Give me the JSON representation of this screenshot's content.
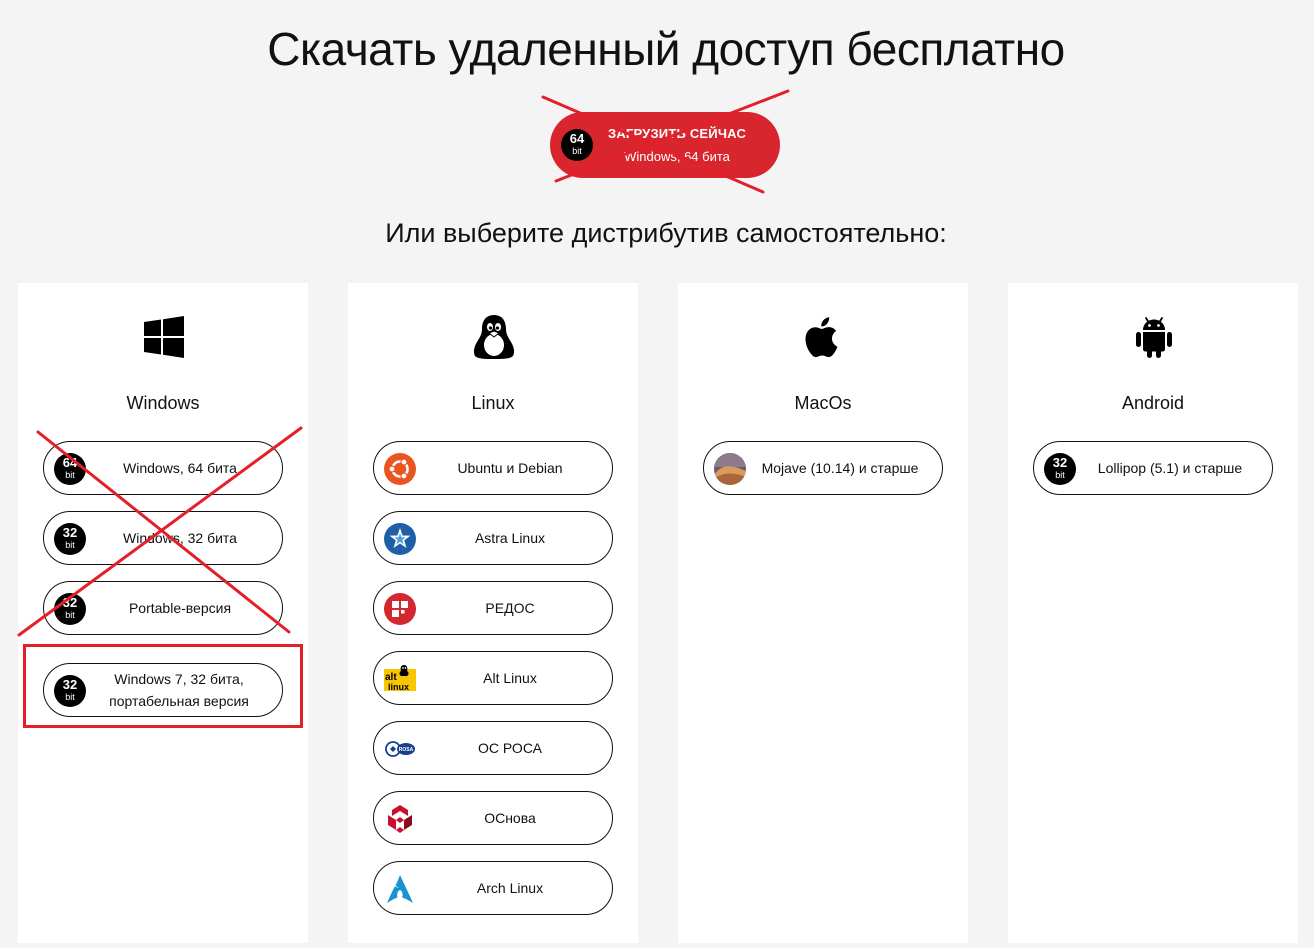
{
  "page": {
    "title": "Скачать удаленный доступ бесплатно",
    "subtitle": "Или выберите дистрибутив самостоятельно:"
  },
  "hero_button": {
    "badge_number": "64",
    "badge_unit": "bit",
    "title": "ЗАГРУЗИТЬ СЕЙЧАС",
    "subtitle": "Windows, 64 бита",
    "color": "#d9262e"
  },
  "platforms": {
    "windows": {
      "name": "Windows",
      "icon": "windows-logo-icon",
      "buttons": [
        {
          "badge_number": "64",
          "badge_unit": "bit",
          "label": "Windows, 64 бита"
        },
        {
          "badge_number": "32",
          "badge_unit": "bit",
          "label": "Windows, 32 бита"
        },
        {
          "badge_number": "32",
          "badge_unit": "bit",
          "label": "Portable-версия"
        },
        {
          "badge_number": "32",
          "badge_unit": "bit",
          "label": "Windows 7, 32 бита, портабельная версия"
        }
      ]
    },
    "linux": {
      "name": "Linux",
      "icon": "tux-penguin-icon",
      "buttons": [
        {
          "icon": "ubuntu-logo-icon",
          "label": "Ubuntu и Debian"
        },
        {
          "icon": "astra-linux-logo-icon",
          "label": "Astra Linux"
        },
        {
          "icon": "redos-logo-icon",
          "label": "РЕДОС"
        },
        {
          "icon": "alt-linux-logo-icon",
          "label": "Alt Linux",
          "logo_text_1": "alt",
          "logo_text_2": "linux"
        },
        {
          "icon": "rosa-logo-icon",
          "label": "ОС РОСА",
          "logo_text": "ROSA"
        },
        {
          "icon": "osnova-logo-icon",
          "label": "ОСнова"
        },
        {
          "icon": "arch-linux-logo-icon",
          "label": "Arch Linux"
        }
      ]
    },
    "macos": {
      "name": "MacOs",
      "icon": "apple-logo-icon",
      "buttons": [
        {
          "icon": "mojave-thumbnail-icon",
          "label": "Mojave (10.14) и старше"
        }
      ]
    },
    "android": {
      "name": "Android",
      "icon": "android-robot-icon",
      "buttons": [
        {
          "badge_number": "32",
          "badge_unit": "bit",
          "label": "Lollipop (5.1) и старше"
        }
      ]
    }
  },
  "annotations": {
    "cross_color": "#e3202a",
    "highlight_color": "#e3202a"
  }
}
